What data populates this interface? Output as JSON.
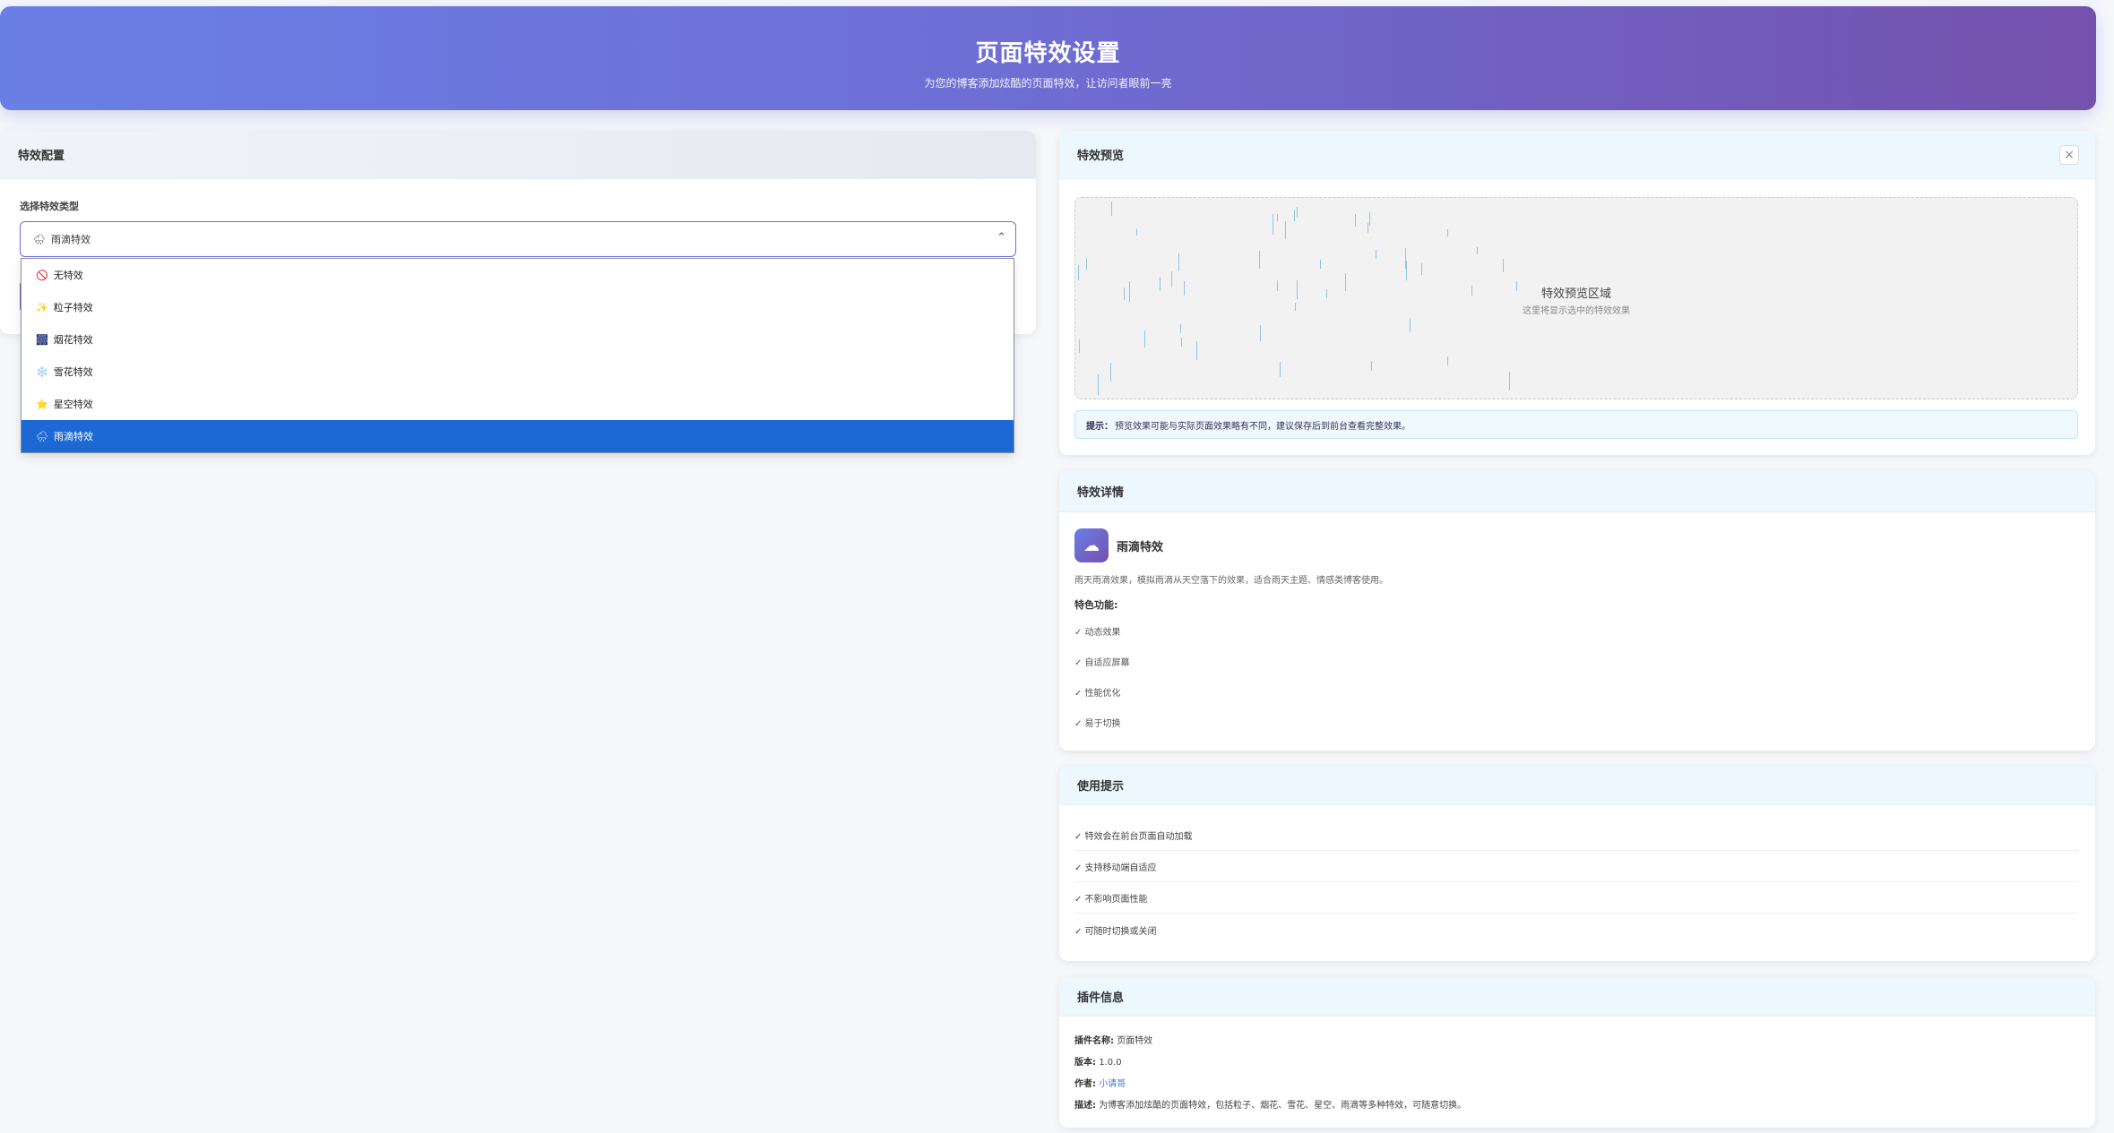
{
  "header": {
    "title": "页面特效设置",
    "subtitle": "为您的博客添加炫酷的页面特效，让访问者眼前一亮"
  },
  "config": {
    "title": "特效配置",
    "field_label": "选择特效类型",
    "selected": {
      "icon": "🌧",
      "label": "雨滴特效"
    },
    "options": [
      {
        "icon": "🚫",
        "label": "无特效",
        "selected": false
      },
      {
        "icon": "✨",
        "label": "粒子特效",
        "selected": false
      },
      {
        "icon": "🎆",
        "label": "烟花特效",
        "selected": false
      },
      {
        "icon": "❄️",
        "label": "雪花特效",
        "selected": false
      },
      {
        "icon": "⭐",
        "label": "星空特效",
        "selected": false
      },
      {
        "icon": "🌧",
        "label": "雨滴特效",
        "selected": true
      }
    ]
  },
  "preview": {
    "title": "特效预览",
    "close_icon": "×",
    "area_title": "特效预览区域",
    "area_subtitle": "这里将显示选中的特效效果",
    "tip_label": "提示：",
    "tip_text": "预览效果可能与实际页面效果略有不同，建议保存后到前台查看完整效果。"
  },
  "details": {
    "title": "特效详情",
    "icon": "☁",
    "name": "雨滴特效",
    "description": "雨天雨滴效果，模拟雨滴从天空落下的效果，适合雨天主题、情感类博客使用。",
    "features_label": "特色功能:",
    "features": [
      "✓ 动态效果",
      "✓ 自适应屏幕",
      "✓ 性能优化",
      "✓ 易于切换"
    ]
  },
  "usage": {
    "title": "使用提示",
    "items": [
      "✓ 特效会在前台页面自动加载",
      "✓ 支持移动端自适应",
      "✓ 不影响页面性能",
      "✓ 可随时切换或关闭"
    ]
  },
  "plugin_info": {
    "title": "插件信息",
    "name_label": "插件名称:",
    "name": "页面特效",
    "version_label": "版本:",
    "version": "1.0.0",
    "author_label": "作者:",
    "author": "小请哥",
    "desc_label": "描述:",
    "desc": "为博客添加炫酷的页面特效，包括粒子、烟花、雪花、星空、雨滴等多种特效，可随意切换。"
  }
}
